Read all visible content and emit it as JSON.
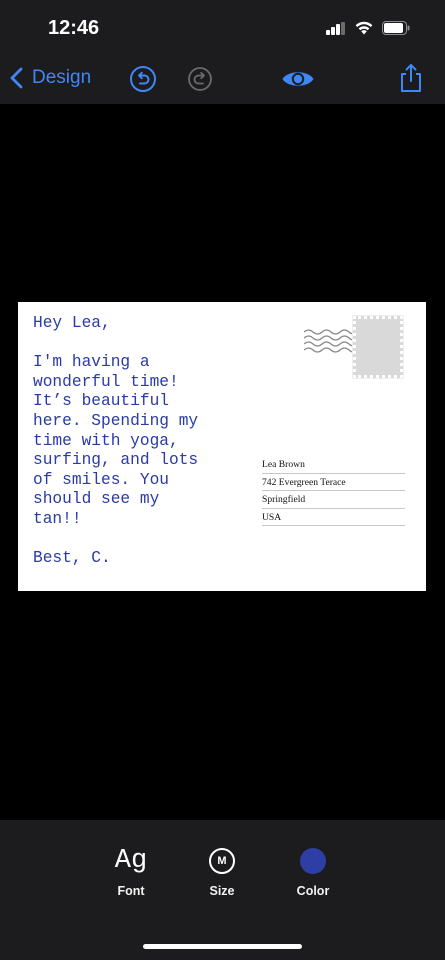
{
  "status_bar": {
    "time": "12:46"
  },
  "nav": {
    "back_label": "Design",
    "accent_color": "#3f86f7",
    "icons": [
      "chevron-left-icon",
      "undo-icon",
      "redo-icon",
      "eye-icon",
      "share-icon"
    ]
  },
  "postcard": {
    "text_color": "#2a3aa8",
    "message_lines": [
      "Hey Lea,",
      "",
      "I'm having a",
      "wonderful time!",
      "It’s beautiful",
      "here. Spending my",
      "time with yoga,",
      "surfing, and lots",
      "of smiles. You",
      "should see my",
      "tan!!",
      "",
      "Best, C."
    ],
    "address": {
      "name": "Lea Brown",
      "street": "742 Evergreen Terace",
      "city": "Springfield",
      "country": "USA"
    }
  },
  "toolbar": {
    "font": {
      "glyph": "Ag",
      "label": "Font"
    },
    "size": {
      "glyph": "M",
      "label": "Size"
    },
    "color": {
      "label": "Color",
      "swatch": "#2f3ea6"
    }
  }
}
